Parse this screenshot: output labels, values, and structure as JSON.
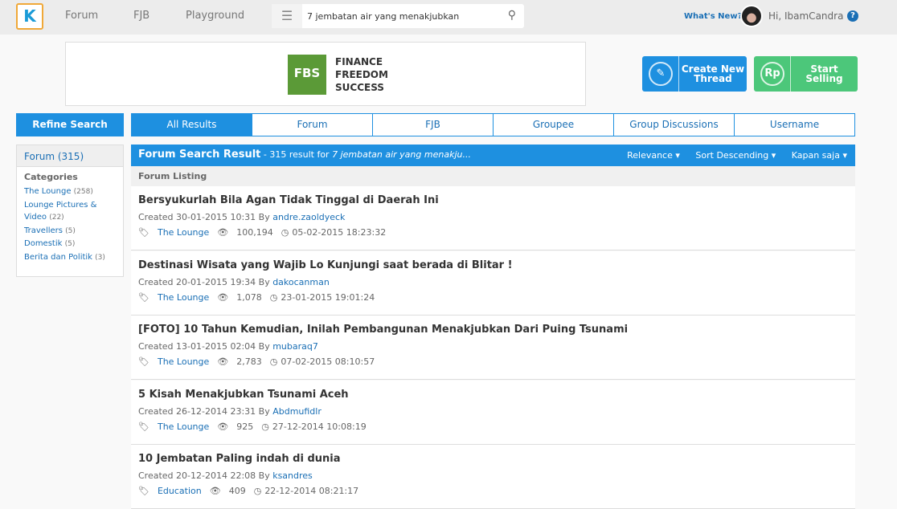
{
  "topbar": {
    "logo": "K",
    "nav": [
      "Forum",
      "FJB",
      "Playground"
    ],
    "search_value": "7 jembatan air yang menakjubkan",
    "whats_new": "What's New?",
    "greeting": "Hi, IbamCandra"
  },
  "banner": {
    "logo": "FBS",
    "lines": [
      "FINANCE",
      "FREEDOM",
      "SUCCESS"
    ]
  },
  "actions": {
    "create": "Create New Thread",
    "sell": "Start Selling",
    "sell_icon": "Rp",
    "create_color": "#1e90e0",
    "sell_color": "#4cc77a"
  },
  "refine": "Refine Search",
  "tabs": [
    "All Results",
    "Forum",
    "FJB",
    "Groupee",
    "Group Discussions",
    "Username"
  ],
  "sidebar": {
    "header": "Forum (315)",
    "categories_label": "Categories",
    "categories": [
      {
        "name": "The Lounge",
        "count": "(258)"
      },
      {
        "name": "Lounge Pictures & Video",
        "count": "(22)"
      },
      {
        "name": "Travellers",
        "count": "(5)"
      },
      {
        "name": "Domestik",
        "count": "(5)"
      },
      {
        "name": "Berita dan Politik",
        "count": "(3)"
      }
    ]
  },
  "results": {
    "title": "Forum Search Result",
    "summary": " - 315 result for ",
    "query": "7 jembatan air yang menakju...",
    "sorts": [
      "Relevance",
      "Sort Descending",
      "Kapan saja"
    ],
    "listing_label": "Forum Listing",
    "items": [
      {
        "title": "Bersyukurlah Bila Agan Tidak Tinggal di Daerah Ini",
        "created": "Created 30-01-2015 10:31 By ",
        "author": "andre.zaoldyeck",
        "category": "The Lounge",
        "views": "100,194",
        "last": "05-02-2015 18:23:32"
      },
      {
        "title": "Destinasi Wisata yang Wajib Lo Kunjungi saat berada di Blitar !",
        "created": "Created 20-01-2015 19:34 By ",
        "author": "dakocanman",
        "category": "The Lounge",
        "views": "1,078",
        "last": "23-01-2015 19:01:24"
      },
      {
        "title": "[FOTO] 10 Tahun Kemudian, Inilah Pembangunan Menakjubkan Dari Puing Tsunami",
        "created": "Created 13-01-2015 02:04 By ",
        "author": "mubaraq7",
        "category": "The Lounge",
        "views": "2,783",
        "last": "07-02-2015 08:10:57"
      },
      {
        "title": "5 Kisah Menakjubkan Tsunami Aceh",
        "created": "Created 26-12-2014 23:31 By ",
        "author": "Abdmufidlr",
        "category": "The Lounge",
        "views": "925",
        "last": "27-12-2014 10:08:19"
      },
      {
        "title": "10 Jembatan Paling indah di dunia",
        "created": "Created 20-12-2014 22:08 By ",
        "author": "ksandres",
        "category": "Education",
        "views": "409",
        "last": "22-12-2014 08:21:17"
      }
    ]
  }
}
